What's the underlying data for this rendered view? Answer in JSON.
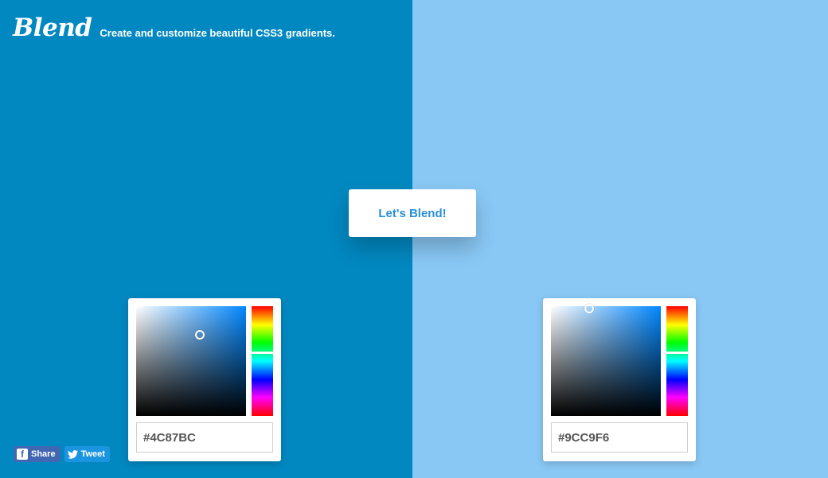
{
  "app": {
    "logo": "Blend",
    "tagline": "Create and customize beautiful CSS3 gradients."
  },
  "cta": {
    "label": "Let's Blend!"
  },
  "colors": {
    "left_background": "#0288C1",
    "right_background": "#89C8F5",
    "cta_text": "#2A8FD6",
    "facebook": "#4267B2",
    "twitter": "#1B95E0"
  },
  "pickers": [
    {
      "hex_value": "#4C87BC",
      "hue_base": "#0288FF",
      "saturation": 0.58,
      "brightness": 0.74,
      "hue_level": 0.43
    },
    {
      "hex_value": "#9CC9F6",
      "hue_base": "#0288FF",
      "saturation": 0.35,
      "brightness": 0.98,
      "hue_level": 0.43
    }
  ],
  "social": {
    "share_label": "Share",
    "tweet_label": "Tweet"
  }
}
